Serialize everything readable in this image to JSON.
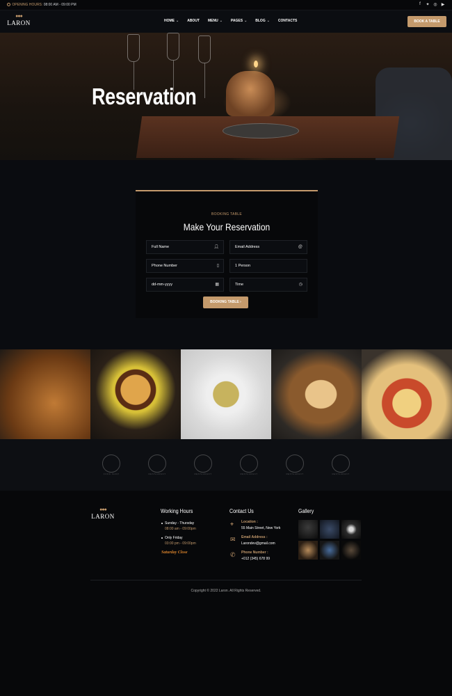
{
  "topbar": {
    "hours_label": "OPENING HOURS:",
    "hours_value": "08:00 AM - 09:00 PM",
    "social_icons": [
      "facebook-icon",
      "twitter-icon",
      "instagram-icon",
      "youtube-icon"
    ]
  },
  "header": {
    "logo_text": "LARON",
    "nav": [
      {
        "label": "HOME",
        "has_dropdown": true
      },
      {
        "label": "ABOUT",
        "has_dropdown": false
      },
      {
        "label": "MENU",
        "has_dropdown": true
      },
      {
        "label": "PAGES",
        "has_dropdown": true
      },
      {
        "label": "BLOG",
        "has_dropdown": true
      },
      {
        "label": "CONTACTS",
        "has_dropdown": false
      }
    ],
    "cta_label": "BOOK A TABLE"
  },
  "hero": {
    "title": "Reservation"
  },
  "reservation": {
    "subtitle": "BOOKING TABLE",
    "title": "Make Your Reservation",
    "fields": {
      "full_name": "Full Name",
      "email": "Email Address",
      "phone": "Phone Number",
      "persons": "1 Person",
      "date": "dd-mm-yyyy",
      "time": "Time"
    },
    "submit_label": "BOOKING TABLE"
  },
  "food_tiles": [
    "fried-chicken",
    "burger",
    "pasta",
    "sandwich",
    "pizza"
  ],
  "brands": [
    "FOOD SHOP",
    "RESTAURANT",
    "RESTAURANT",
    "RESTAURANT",
    "RESTAURANT",
    "RESTAURANT"
  ],
  "footer": {
    "logo_text": "LARON",
    "working_hours": {
      "title": "Working Hours",
      "day1": "Sunday - Thursday",
      "time1": "08:00 am - 09:00pm",
      "day2": "Only Friday",
      "time2": "03:00 pm - 09:00pm",
      "closed": "Saturday Close"
    },
    "contact": {
      "title": "Contact Us",
      "location_label": "Location :",
      "location_value": "55 Main Street, New York",
      "email_label": "Email Address :",
      "email_value": "Larondev@gmail.com",
      "phone_label": "Phone Number :",
      "phone_value": "+012 (345) 678 99"
    },
    "gallery_title": "Gallery",
    "copyright": "Copyright © 2022 Laron. All Rights Reserved."
  },
  "colors": {
    "accent": "#c49a6c",
    "background": "#0a0c10",
    "saturday_close": "#d9822b"
  }
}
